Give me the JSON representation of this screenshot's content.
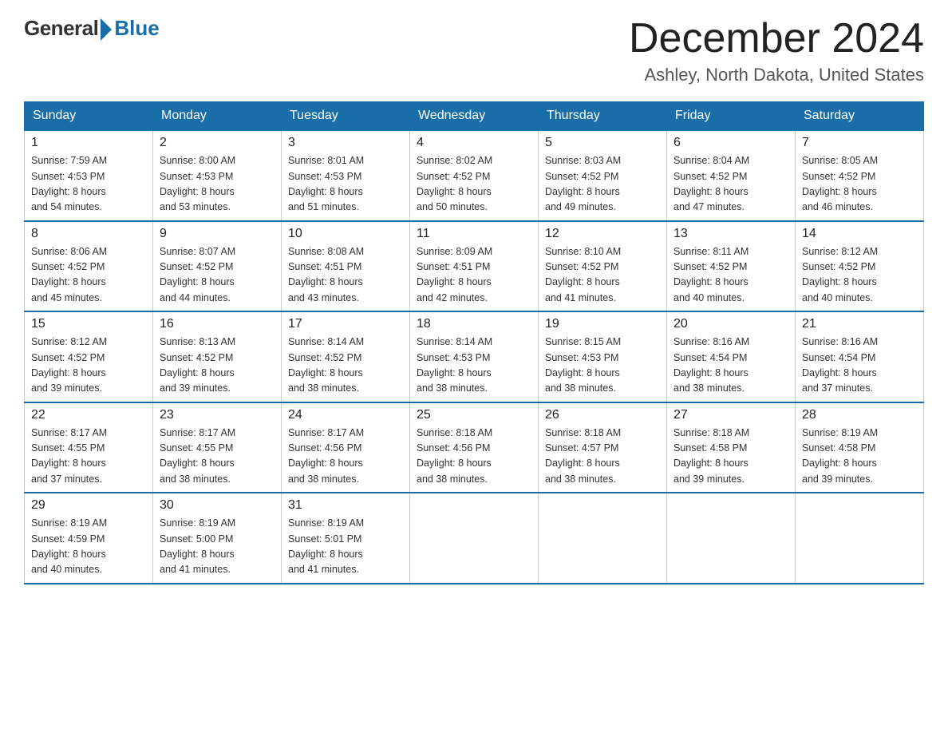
{
  "header": {
    "logo_general": "General",
    "logo_blue": "Blue",
    "month_year": "December 2024",
    "location": "Ashley, North Dakota, United States"
  },
  "days_of_week": [
    "Sunday",
    "Monday",
    "Tuesday",
    "Wednesday",
    "Thursday",
    "Friday",
    "Saturday"
  ],
  "weeks": [
    [
      {
        "day": "1",
        "sunrise": "7:59 AM",
        "sunset": "4:53 PM",
        "daylight": "8 hours and 54 minutes."
      },
      {
        "day": "2",
        "sunrise": "8:00 AM",
        "sunset": "4:53 PM",
        "daylight": "8 hours and 53 minutes."
      },
      {
        "day": "3",
        "sunrise": "8:01 AM",
        "sunset": "4:53 PM",
        "daylight": "8 hours and 51 minutes."
      },
      {
        "day": "4",
        "sunrise": "8:02 AM",
        "sunset": "4:52 PM",
        "daylight": "8 hours and 50 minutes."
      },
      {
        "day": "5",
        "sunrise": "8:03 AM",
        "sunset": "4:52 PM",
        "daylight": "8 hours and 49 minutes."
      },
      {
        "day": "6",
        "sunrise": "8:04 AM",
        "sunset": "4:52 PM",
        "daylight": "8 hours and 47 minutes."
      },
      {
        "day": "7",
        "sunrise": "8:05 AM",
        "sunset": "4:52 PM",
        "daylight": "8 hours and 46 minutes."
      }
    ],
    [
      {
        "day": "8",
        "sunrise": "8:06 AM",
        "sunset": "4:52 PM",
        "daylight": "8 hours and 45 minutes."
      },
      {
        "day": "9",
        "sunrise": "8:07 AM",
        "sunset": "4:52 PM",
        "daylight": "8 hours and 44 minutes."
      },
      {
        "day": "10",
        "sunrise": "8:08 AM",
        "sunset": "4:51 PM",
        "daylight": "8 hours and 43 minutes."
      },
      {
        "day": "11",
        "sunrise": "8:09 AM",
        "sunset": "4:51 PM",
        "daylight": "8 hours and 42 minutes."
      },
      {
        "day": "12",
        "sunrise": "8:10 AM",
        "sunset": "4:52 PM",
        "daylight": "8 hours and 41 minutes."
      },
      {
        "day": "13",
        "sunrise": "8:11 AM",
        "sunset": "4:52 PM",
        "daylight": "8 hours and 40 minutes."
      },
      {
        "day": "14",
        "sunrise": "8:12 AM",
        "sunset": "4:52 PM",
        "daylight": "8 hours and 40 minutes."
      }
    ],
    [
      {
        "day": "15",
        "sunrise": "8:12 AM",
        "sunset": "4:52 PM",
        "daylight": "8 hours and 39 minutes."
      },
      {
        "day": "16",
        "sunrise": "8:13 AM",
        "sunset": "4:52 PM",
        "daylight": "8 hours and 39 minutes."
      },
      {
        "day": "17",
        "sunrise": "8:14 AM",
        "sunset": "4:52 PM",
        "daylight": "8 hours and 38 minutes."
      },
      {
        "day": "18",
        "sunrise": "8:14 AM",
        "sunset": "4:53 PM",
        "daylight": "8 hours and 38 minutes."
      },
      {
        "day": "19",
        "sunrise": "8:15 AM",
        "sunset": "4:53 PM",
        "daylight": "8 hours and 38 minutes."
      },
      {
        "day": "20",
        "sunrise": "8:16 AM",
        "sunset": "4:54 PM",
        "daylight": "8 hours and 38 minutes."
      },
      {
        "day": "21",
        "sunrise": "8:16 AM",
        "sunset": "4:54 PM",
        "daylight": "8 hours and 37 minutes."
      }
    ],
    [
      {
        "day": "22",
        "sunrise": "8:17 AM",
        "sunset": "4:55 PM",
        "daylight": "8 hours and 37 minutes."
      },
      {
        "day": "23",
        "sunrise": "8:17 AM",
        "sunset": "4:55 PM",
        "daylight": "8 hours and 38 minutes."
      },
      {
        "day": "24",
        "sunrise": "8:17 AM",
        "sunset": "4:56 PM",
        "daylight": "8 hours and 38 minutes."
      },
      {
        "day": "25",
        "sunrise": "8:18 AM",
        "sunset": "4:56 PM",
        "daylight": "8 hours and 38 minutes."
      },
      {
        "day": "26",
        "sunrise": "8:18 AM",
        "sunset": "4:57 PM",
        "daylight": "8 hours and 38 minutes."
      },
      {
        "day": "27",
        "sunrise": "8:18 AM",
        "sunset": "4:58 PM",
        "daylight": "8 hours and 39 minutes."
      },
      {
        "day": "28",
        "sunrise": "8:19 AM",
        "sunset": "4:58 PM",
        "daylight": "8 hours and 39 minutes."
      }
    ],
    [
      {
        "day": "29",
        "sunrise": "8:19 AM",
        "sunset": "4:59 PM",
        "daylight": "8 hours and 40 minutes."
      },
      {
        "day": "30",
        "sunrise": "8:19 AM",
        "sunset": "5:00 PM",
        "daylight": "8 hours and 41 minutes."
      },
      {
        "day": "31",
        "sunrise": "8:19 AM",
        "sunset": "5:01 PM",
        "daylight": "8 hours and 41 minutes."
      },
      null,
      null,
      null,
      null
    ]
  ],
  "labels": {
    "sunrise": "Sunrise:",
    "sunset": "Sunset:",
    "daylight": "Daylight:"
  }
}
